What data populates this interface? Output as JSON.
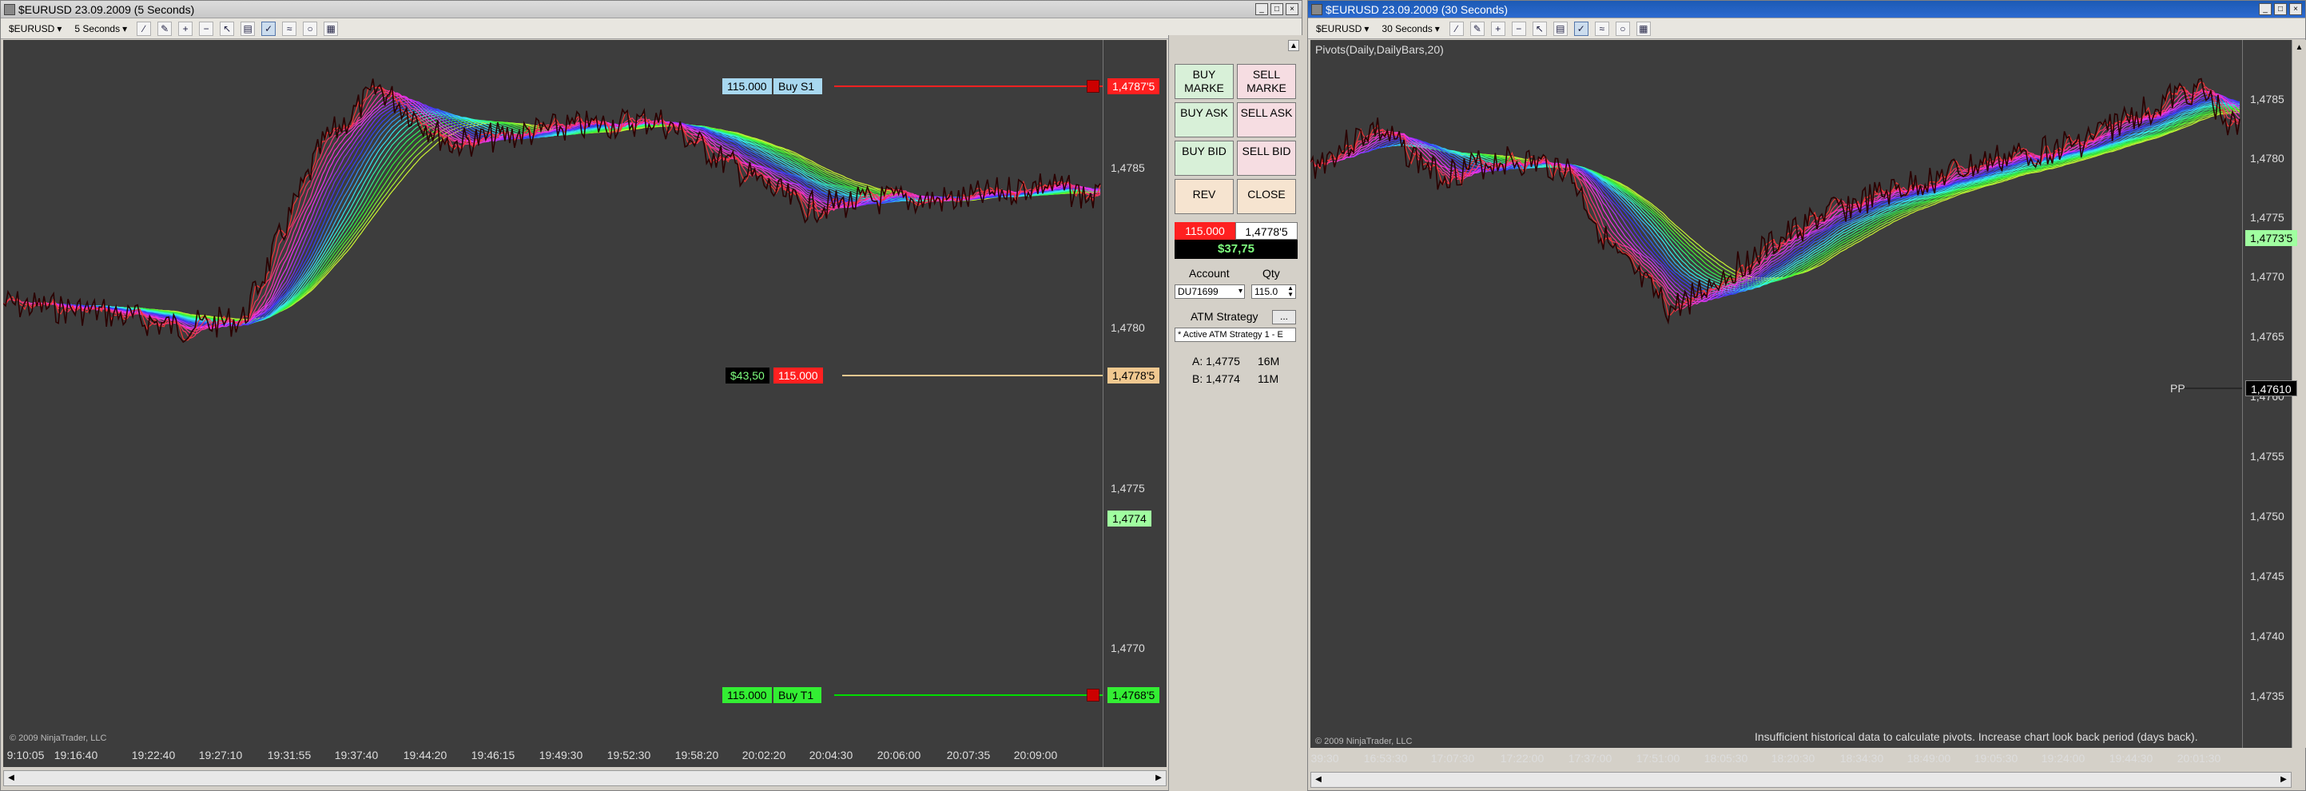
{
  "left_window": {
    "title": "$EURUSD  23.09.2009 (5 Seconds)",
    "toolbar": {
      "instrument": "$EURUSD",
      "interval": "5 Seconds"
    },
    "price_ticks": [
      "1,4785",
      "1,4780",
      "1,4775",
      "1,4770"
    ],
    "time_ticks": [
      "9:10:05",
      "19:16:40",
      "19:22:40",
      "19:27:10",
      "19:31:55",
      "19:37:40",
      "19:44:20",
      "19:46:15",
      "19:49:30",
      "19:52:30",
      "19:58:20",
      "20:02:20",
      "20:04:30",
      "20:06:00",
      "20:07:35",
      "20:09:00"
    ],
    "copyright": "© 2009 NinjaTrader, LLC",
    "orders": {
      "stop": {
        "qty": "115.000",
        "label": "Buy S1",
        "price": "1,4787'5"
      },
      "position": {
        "pnl": "$43,50",
        "qty": "115.000",
        "price": "1,4778'5"
      },
      "target": {
        "qty": "115.000",
        "label": "Buy T1",
        "price": "1,4768'5"
      }
    },
    "last_price": "1,4774"
  },
  "order_panel": {
    "buy_market": "BUY MARKE",
    "sell_market": "SELL MARKE",
    "buy_ask": "BUY ASK",
    "sell_ask": "SELL ASK",
    "buy_bid": "BUY BID",
    "sell_bid": "SELL BID",
    "rev": "REV",
    "close": "CLOSE",
    "position_qty": "115.000",
    "position_price": "1,4778'5",
    "pnl": "$37,75",
    "account_label": "Account",
    "qty_label": "Qty",
    "account_value": "DU71699",
    "qty_value": "115.0",
    "atm_label": "ATM Strategy",
    "atm_more": "...",
    "atm_value": "* Active ATM Strategy 1 - E",
    "ask": "A: 1,4775",
    "ask_size": "16M",
    "bid": "B: 1,4774",
    "bid_size": "11M"
  },
  "right_window": {
    "title": "$EURUSD  23.09.2009 (30 Seconds)",
    "toolbar": {
      "instrument": "$EURUSD",
      "interval": "30 Seconds"
    },
    "indicator_label": "Pivots(Daily,DailyBars,20)",
    "price_ticks": [
      "1,4785",
      "1,4780",
      "1,4775",
      "1,4770",
      "1,4765",
      "1,4760",
      "1,4755",
      "1,4750",
      "1,4745",
      "1,4740",
      "1,4735"
    ],
    "time_ticks": [
      "39:30",
      "16:53:30",
      "17:07:30",
      "17:22:00",
      "17:37:00",
      "17:51:00",
      "18:05:30",
      "18:20:30",
      "18:34:30",
      "18:49:00",
      "19:05:30",
      "19:24:00",
      "19:44:30",
      "20:01:30"
    ],
    "pivot_label": "PP",
    "pivot_price": "1,47610",
    "last_price": "1,4773'5",
    "copyright": "© 2009 NinjaTrader, LLC",
    "message": "Insufficient historical data to calculate pivots. Increase chart look back period (days back)."
  },
  "colors": {
    "chart_bg": "#3d3d3d",
    "price_line": "#300000",
    "stop": "#ff2020",
    "target": "#00dd00",
    "position": "#f0c890"
  }
}
